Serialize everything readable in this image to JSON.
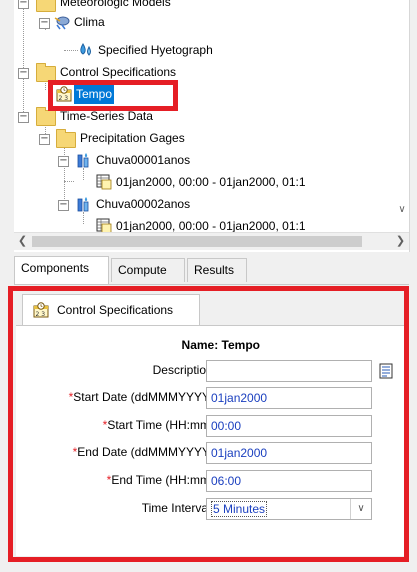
{
  "tree": {
    "meteorologic_models": "Meteorologic Models",
    "clima": "Clima",
    "specified_hyetograph": "Specified Hyetograph",
    "control_specifications": "Control Specifications",
    "tempo": "Tempo",
    "time_series_data": "Time-Series Data",
    "precipitation_gages": "Precipitation Gages",
    "chuva1": "Chuva00001anos",
    "chuva1_range": "01jan2000, 00:00 - 01jan2000, 01:1",
    "chuva2": "Chuva00002anos",
    "chuva2_range": "01jan2000, 00:00 - 01jan2000, 01:1"
  },
  "tabs": {
    "components": "Components",
    "compute": "Compute",
    "results": "Results"
  },
  "panel": {
    "tab_label": "Control Specifications",
    "name_label": "Name: Tempo",
    "description_label": "Description:",
    "description_value": "",
    "required_mark": "*",
    "start_date_label": "Start Date (ddMMMYYYY)",
    "start_date_value": "01jan2000",
    "start_time_label": "Start Time (HH:mm)",
    "start_time_value": "00:00",
    "end_date_label": "End Date (ddMMMYYYY)",
    "end_date_value": "01jan2000",
    "end_time_label": "End Time (HH:mm)",
    "end_time_value": "06:00",
    "time_interval_label": "Time Interval:",
    "time_interval_value": "5 Minutes"
  },
  "colors": {
    "highlight": "#e51e25",
    "selection": "#0078d7",
    "value_text": "#1a3fbf"
  }
}
